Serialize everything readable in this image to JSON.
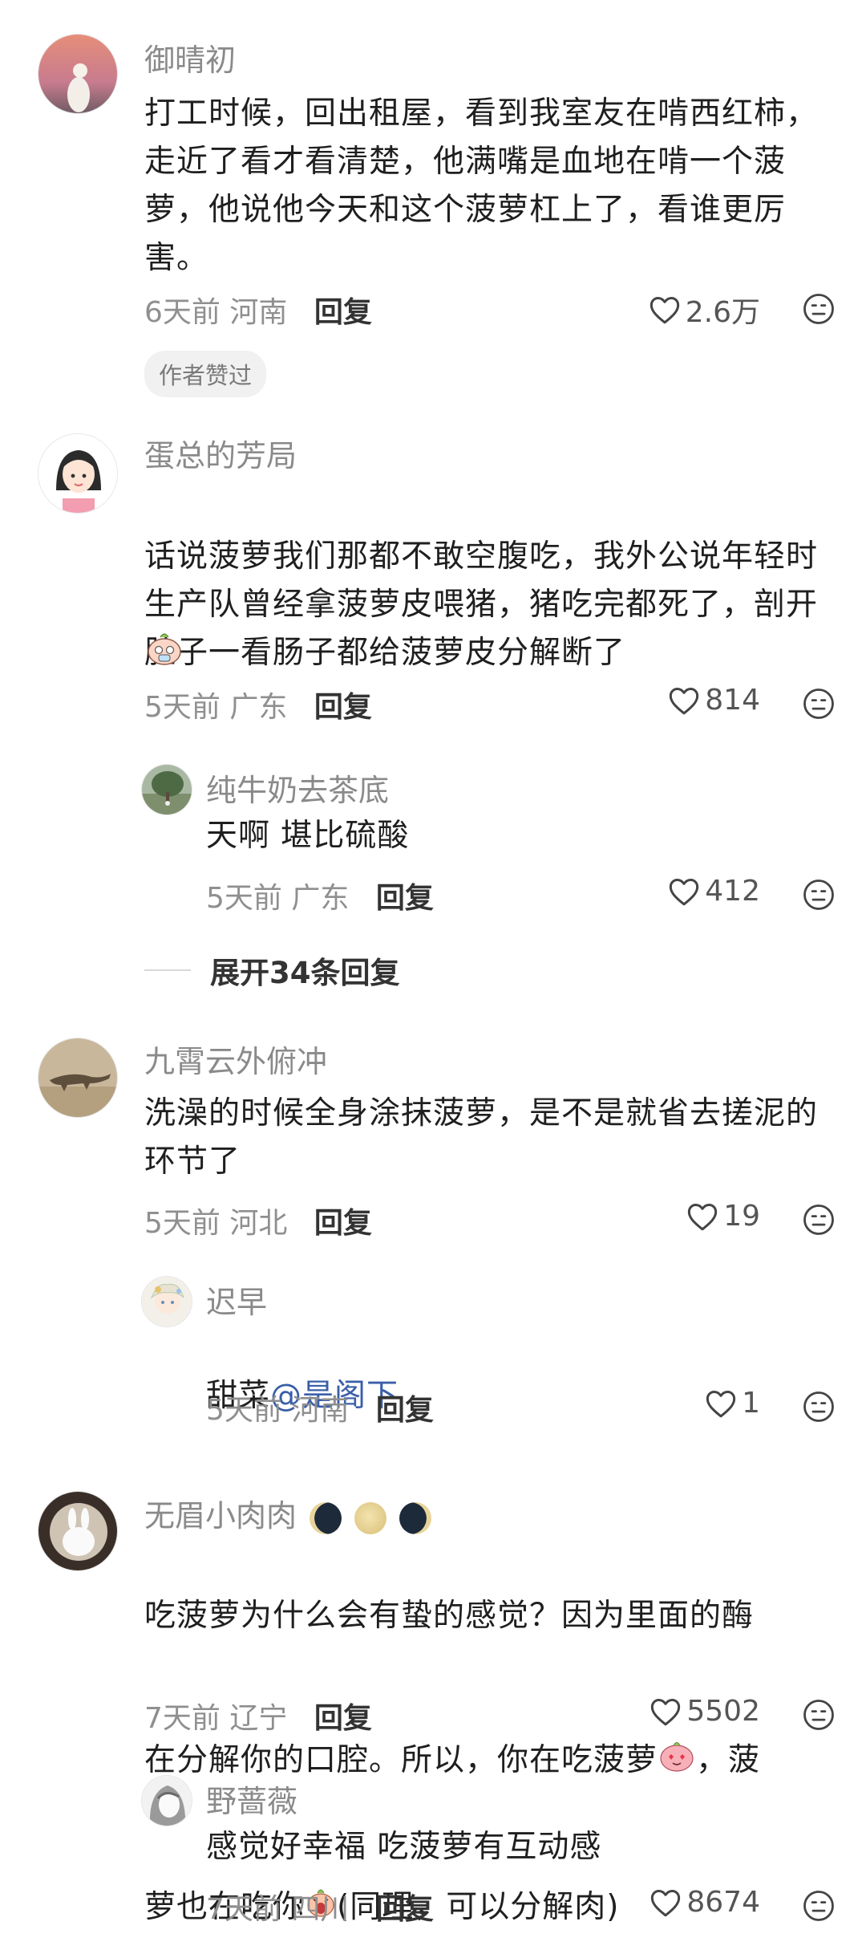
{
  "comments": [
    {
      "name": "御晴初",
      "text": "打工时候，回出租屋，看到我室友在啃西红柿，走近了看才看清楚，他满嘴是血地在啃一个菠萝，他说他今天和这个菠萝杠上了，看谁更厉害。",
      "time": "6天前",
      "location": "河南",
      "reply_label": "回复",
      "likes": "2.6万",
      "badge": "作者赞过"
    },
    {
      "name": "蛋总的芳局",
      "text": "话说菠萝我们那都不敢空腹吃，我外公说年轻时生产队曾经拿菠萝皮喂猪，猪吃完都死了，剖开肚子一看肠子都给菠萝皮分解断了",
      "time": "5天前",
      "location": "广东",
      "reply_label": "回复",
      "likes": "814",
      "replies": [
        {
          "name": "纯牛奶去茶底",
          "text": "天啊 堪比硫酸",
          "time": "5天前",
          "location": "广东",
          "reply_label": "回复",
          "likes": "412"
        }
      ],
      "expand_label": "展开34条回复"
    },
    {
      "name": "九霄云外俯冲",
      "text": "洗澡的时候全身涂抹菠萝，是不是就省去搓泥的环节了",
      "time": "5天前",
      "location": "河北",
      "reply_label": "回复",
      "likes": "19",
      "replies": [
        {
          "name": "迟早",
          "text_prefix": "甜菜",
          "mention": "@是阁下",
          "time": "5天前",
          "location": "河南",
          "reply_label": "回复",
          "likes": "1"
        }
      ]
    },
    {
      "name": "无眉小肉肉",
      "text_line1": "吃菠萝为什么会有蛰的感觉？因为里面的酶",
      "text_line2a": "在分解你的口腔。所以，你在吃菠萝",
      "text_line2b": "，菠",
      "text_line3a": "萝也在吃你",
      "text_line3b": "(同理，可以分解肉)",
      "time": "7天前",
      "location": "辽宁",
      "reply_label": "回复",
      "likes": "5502",
      "replies": [
        {
          "name": "野蔷薇",
          "text": "感觉好幸福 吃菠萝有互动感",
          "time": "7天前",
          "location": "四川",
          "reply_label": "回复",
          "likes": "8674"
        }
      ]
    }
  ],
  "icons": {
    "like": "heart-outline-icon",
    "more": "neutral-face-icon"
  },
  "colors": {
    "name": "#8a8a8a",
    "mention": "#3a5fa8",
    "meta": "#8f8f8f"
  }
}
